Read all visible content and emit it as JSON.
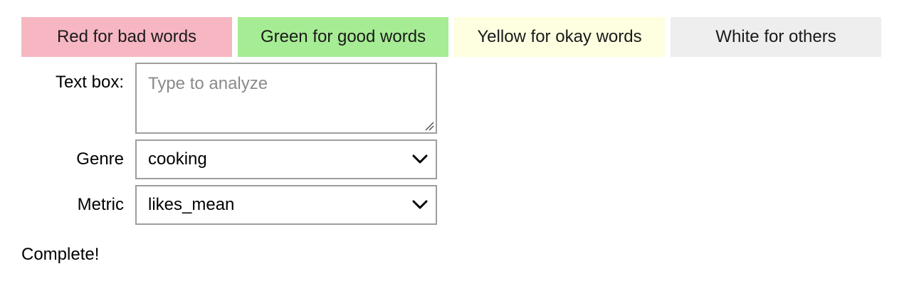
{
  "legend": {
    "items": [
      {
        "label": "Red for bad words",
        "color": "#f6b7c2"
      },
      {
        "label": "Green for good words",
        "color": "#a6ec94"
      },
      {
        "label": "Yellow for okay words",
        "color": "#fefee0"
      },
      {
        "label": "White for others",
        "color": "#eeeeee"
      }
    ]
  },
  "form": {
    "textbox": {
      "label": "Text box:",
      "value": "",
      "placeholder": "Type to analyze"
    },
    "genre": {
      "label": "Genre",
      "selected": "cooking"
    },
    "metric": {
      "label": "Metric",
      "selected": "likes_mean"
    }
  },
  "status": {
    "text": "Complete!"
  },
  "icons": {
    "dropdown": "chevron-down-icon",
    "resize": "resize-grip-icon"
  }
}
